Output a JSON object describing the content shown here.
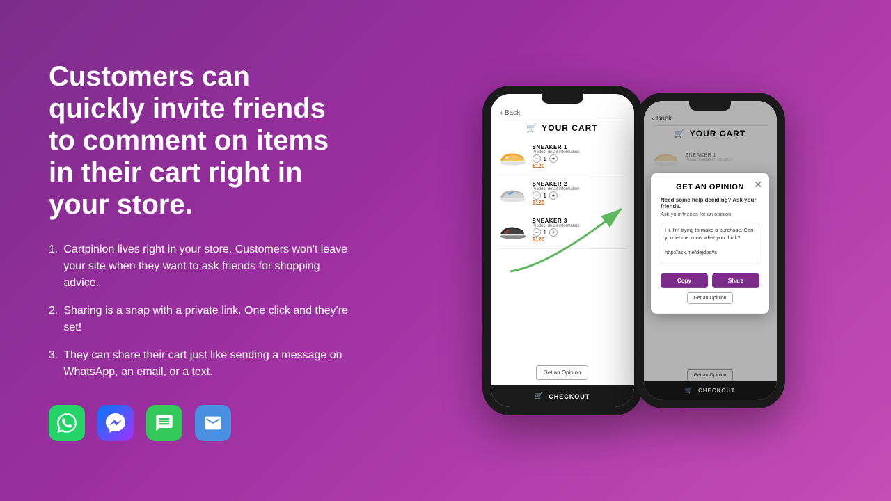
{
  "left": {
    "headline": "Customers can quickly invite friends to comment on items in their cart right in your store.",
    "points": [
      {
        "text": "Cartpinion lives right in your store. Customers won't leave your site when they want to ask friends for shopping advice."
      },
      {
        "text": "Sharing is a snap with a private link. One click and they're set!"
      },
      {
        "text": "They can share their cart just like sending a message on WhatsApp, an email, or a text."
      }
    ],
    "icons": [
      "whatsapp",
      "messenger",
      "imessage",
      "mail"
    ]
  },
  "phone1": {
    "back_label": "Back",
    "title": "YOUR CART",
    "items": [
      {
        "name": "SNEAKER 1",
        "detail": "Product detail information",
        "qty": "1",
        "price": "$120"
      },
      {
        "name": "SNEAKER 2",
        "detail": "Product detail information",
        "qty": "1",
        "price": "$120"
      },
      {
        "name": "SNEAKER 3",
        "detail": "Product detail information",
        "qty": "1",
        "price": "$120"
      }
    ],
    "get_opinion_btn": "Get an Opinion",
    "checkout_label": "CHECKOUT"
  },
  "phone2": {
    "back_label": "Back",
    "title": "YOUR CART",
    "item_partial": "SNEAKER 1",
    "checkout_label": "CHECKOUT",
    "modal": {
      "title": "GET AN OPINION",
      "subtitle": "Need some help deciding? Ask your friends.",
      "sub2": "Ask your friends for an opinion.",
      "message": "Hi, I'm trying to make a purchase. Can you let me know what you think?\n\nhttp://ask.me/dejdps#s",
      "copy_label": "Copy",
      "share_label": "Share",
      "get_opinion_btn": "Get an Opinion"
    }
  },
  "colors": {
    "background_start": "#7b2d8b",
    "background_end": "#c44db5",
    "accent": "#7b2d8b",
    "price_color": "#b8651e"
  }
}
